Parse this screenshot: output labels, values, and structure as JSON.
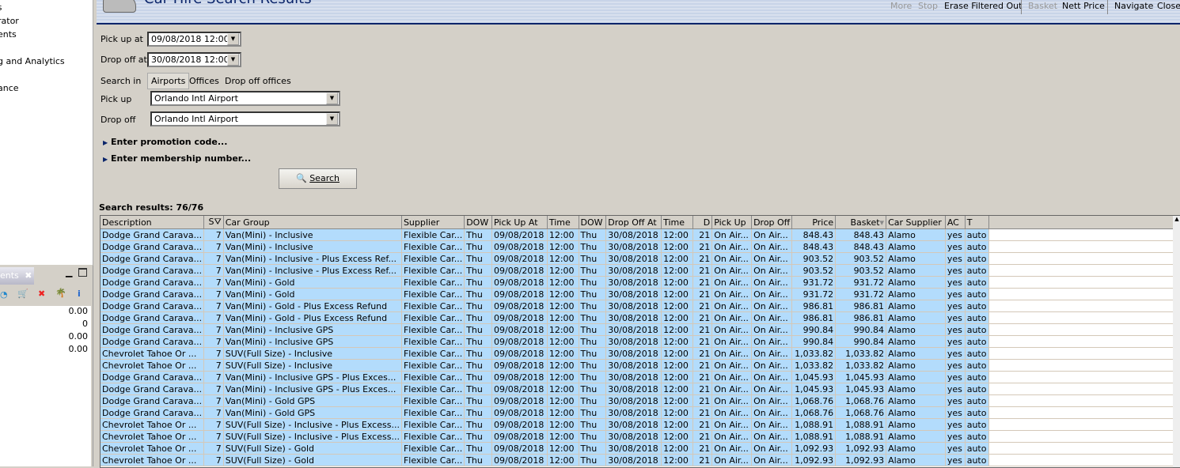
{
  "left_nav": {
    "items": [
      "otes",
      "rator",
      "ents",
      "s",
      "g and Analytics",
      "a",
      "ance"
    ]
  },
  "bottom_panel": {
    "tab_label": "ents",
    "values": [
      "0.00",
      "0",
      "0.00",
      "0.00"
    ]
  },
  "header": {
    "title": "Car Hire Search Results"
  },
  "toolbar": {
    "more": "More",
    "stop": "Stop",
    "erase": "Erase Filtered Out",
    "basket": "Basket",
    "nett_price": "Nett Price",
    "navigate": "Navigate",
    "close": "Close"
  },
  "form": {
    "pickup_at_label": "Pick up at",
    "pickup_at_value": "09/08/2018 12:00",
    "dropoff_at_label": "Drop off at",
    "dropoff_at_value": "30/08/2018 12:00",
    "search_in_label": "Search in",
    "search_in_options": [
      "Airports",
      "Offices",
      "Drop off offices"
    ],
    "pickup_label": "Pick up",
    "pickup_value": "Orlando Intl Airport",
    "dropoff_label": "Drop off",
    "dropoff_value": "Orlando Intl Airport",
    "promo": "Enter promotion code...",
    "membership": "Enter membership number...",
    "search_button": "Search"
  },
  "results": {
    "summary": "Search results: 76/76",
    "columns": [
      "Description",
      "S",
      "Car Group",
      "Supplier",
      "DOW",
      "Pick Up At",
      "Time",
      "DOW",
      "Drop Off At",
      "Time",
      "D",
      "Pick Up",
      "Drop Off",
      "Price",
      "Basket",
      "Car Supplier",
      "AC",
      "T"
    ],
    "rows": [
      [
        "Dodge Grand Carava...",
        "7",
        "Van(Mini) - Inclusive",
        "848.43"
      ],
      [
        "Dodge Grand Carava...",
        "7",
        "Van(Mini) - Inclusive",
        "848.43"
      ],
      [
        "Dodge Grand Carava...",
        "7",
        "Van(Mini) - Inclusive - Plus Excess Ref...",
        "903.52"
      ],
      [
        "Dodge Grand Carava...",
        "7",
        "Van(Mini) - Inclusive - Plus Excess Ref...",
        "903.52"
      ],
      [
        "Dodge Grand Carava...",
        "7",
        "Van(Mini) - Gold",
        "931.72"
      ],
      [
        "Dodge Grand Carava...",
        "7",
        "Van(Mini) - Gold",
        "931.72"
      ],
      [
        "Dodge Grand Carava...",
        "7",
        "Van(Mini) - Gold - Plus Excess Refund",
        "986.81"
      ],
      [
        "Dodge Grand Carava...",
        "7",
        "Van(Mini) - Gold - Plus Excess Refund",
        "986.81"
      ],
      [
        "Dodge Grand Carava...",
        "7",
        "Van(Mini) - Inclusive GPS",
        "990.84"
      ],
      [
        "Dodge Grand Carava...",
        "7",
        "Van(Mini) - Inclusive GPS",
        "990.84"
      ],
      [
        "Chevrolet Tahoe Or ...",
        "7",
        "SUV(Full Size) - Inclusive",
        "1,033.82"
      ],
      [
        "Chevrolet Tahoe Or ...",
        "7",
        "SUV(Full Size) - Inclusive",
        "1,033.82"
      ],
      [
        "Dodge Grand Carava...",
        "7",
        "Van(Mini) - Inclusive GPS - Plus Exces...",
        "1,045.93"
      ],
      [
        "Dodge Grand Carava...",
        "7",
        "Van(Mini) - Inclusive GPS - Plus Exces...",
        "1,045.93"
      ],
      [
        "Dodge Grand Carava...",
        "7",
        "Van(Mini) - Gold GPS",
        "1,068.76"
      ],
      [
        "Dodge Grand Carava...",
        "7",
        "Van(Mini) - Gold GPS",
        "1,068.76"
      ],
      [
        "Chevrolet Tahoe Or ...",
        "7",
        "SUV(Full Size) - Inclusive - Plus Excess...",
        "1,088.91"
      ],
      [
        "Chevrolet Tahoe Or ...",
        "7",
        "SUV(Full Size) - Inclusive - Plus Excess...",
        "1,088.91"
      ],
      [
        "Chevrolet Tahoe Or ...",
        "7",
        "SUV(Full Size) - Gold",
        "1,092.93"
      ],
      [
        "Chevrolet Tahoe Or ...",
        "7",
        "SUV(Full Size) - Gold",
        "1,092.93"
      ]
    ],
    "common": {
      "supplier": "Flexible Car...",
      "dow1": "Thu",
      "pickup_at": "09/08/2018",
      "time1": "12:00",
      "dow2": "Thu",
      "dropoff_at": "30/08/2018",
      "time2": "12:00",
      "days": "21",
      "pickup": "On Air...",
      "dropoff": "On Air...",
      "car_supplier": "Alamo",
      "ac": "yes",
      "t": "auto"
    }
  }
}
